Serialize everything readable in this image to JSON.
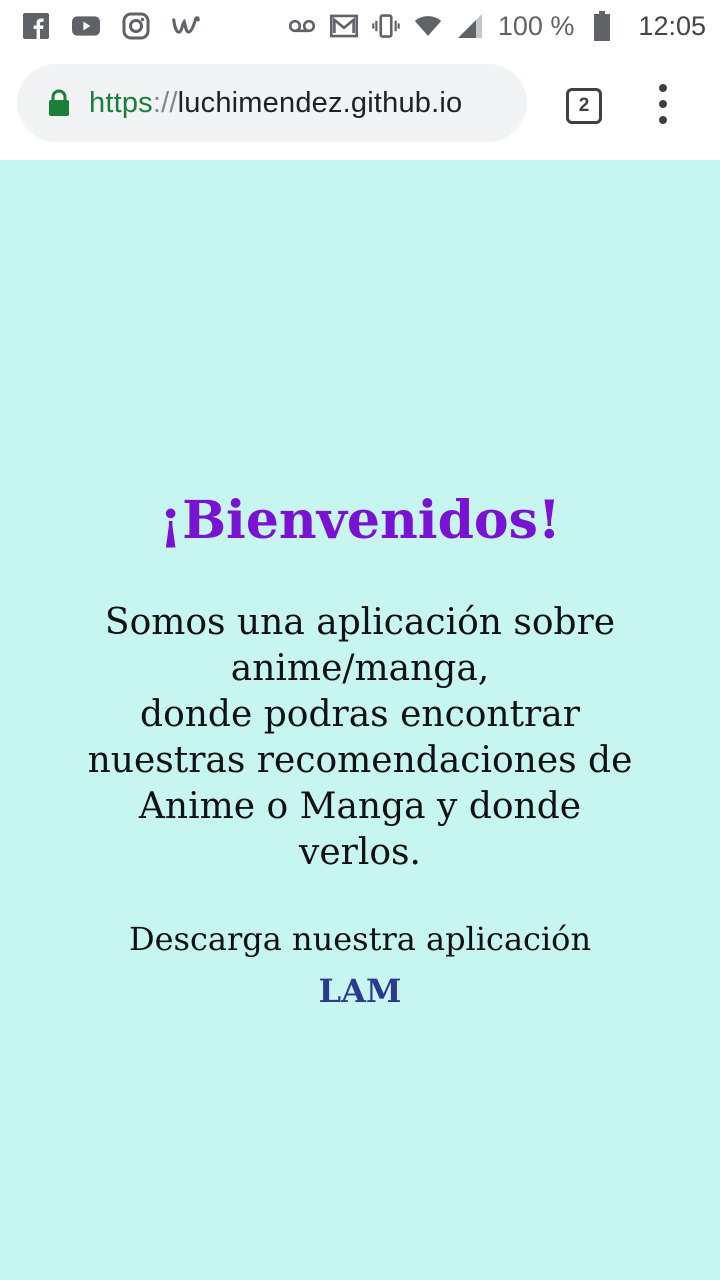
{
  "status_bar": {
    "icons_left": [
      "facebook-icon",
      "youtube-icon",
      "instagram-icon",
      "wish-icon"
    ],
    "icons_right": [
      "voicemail-icon",
      "gmail-icon",
      "vibrate-icon",
      "wifi-icon",
      "signal-icon"
    ],
    "battery": "100 %",
    "time": "12:05"
  },
  "browser": {
    "url_scheme": "https",
    "url_separator": "://",
    "url_host": "luchimendez.github.io",
    "tab_count": "2",
    "colors": {
      "secure": "#188038",
      "omnibox_bg": "#f1f3f4"
    }
  },
  "page": {
    "background": "#c7f5ef",
    "heading": "¡Bienvenidos!",
    "heading_color": "#7a12d4",
    "description_lines": [
      "Somos una aplicación sobre anime/manga,",
      "donde podras encontrar nuestras recomendaciones de Anime o Manga y donde verlos."
    ],
    "download_text": "Descarga nuestra aplicación",
    "app_link": "LAM",
    "link_color": "#2b3a8f"
  }
}
